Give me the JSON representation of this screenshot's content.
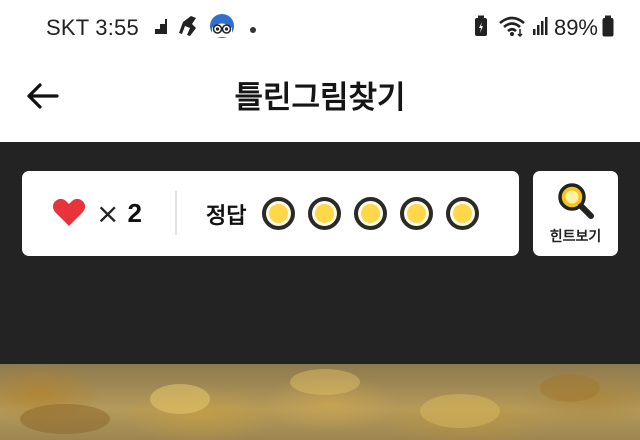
{
  "status_bar": {
    "carrier_time": "SKT 3:55",
    "battery": "89%",
    "icons": [
      "stairs-icon",
      "runner-icon",
      "owl-app-icon",
      "dot-icon",
      "battery-saver-icon",
      "wifi-icon",
      "signal-icon",
      "battery-icon"
    ]
  },
  "header": {
    "title": "틀린그림찾기",
    "back_icon": "arrow-left-icon"
  },
  "game": {
    "lives_icon": "heart-icon",
    "lives_multiplier": "×",
    "lives_count": "2",
    "answers_label": "정답",
    "answer_slots": 5,
    "hint_label": "힌트보기",
    "hint_icon": "magnifier-icon"
  },
  "colors": {
    "panel_bg": "#232323",
    "heart": "#e8333c",
    "answer_fill": "#ffd84a",
    "hint_icon": "#f5c518"
  }
}
